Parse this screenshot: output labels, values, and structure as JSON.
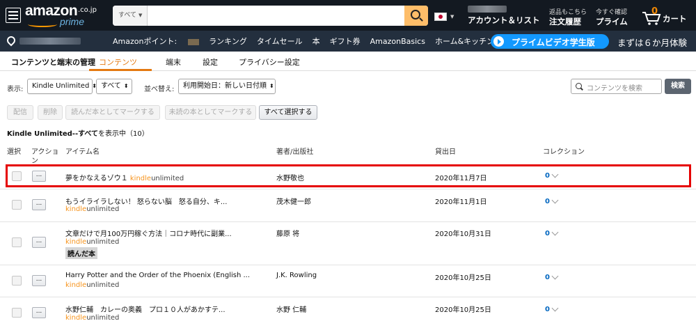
{
  "nav": {
    "logo_text": "amazon",
    "logo_tld": ".co.jp",
    "logo_prime": "prime",
    "search_category": "すべて",
    "account_label": "アカウント＆リスト",
    "orders_small": "返品もこちら",
    "orders_label": "注文履歴",
    "prime_small": "今すぐ確認",
    "prime_label": "プライム",
    "cart_count": "0",
    "cart_label": "カート"
  },
  "subnav": {
    "links": [
      "Amazonポイント:",
      "ランキング",
      "タイムセール",
      "本",
      "ギフト券",
      "AmazonBasics",
      "ホーム&キッチン"
    ],
    "promo_label": "プライムビデオ学生版",
    "promo_tail": "まずは６か月体験"
  },
  "tabs": {
    "manager_title": "コンテンツと端末の管理",
    "items": [
      "コンテンツ",
      "端末",
      "設定",
      "プライバシー設定"
    ],
    "active_index": 0
  },
  "filters": {
    "show_label": "表示:",
    "type_value": "Kindle Unlimited",
    "scope_value": "すべて",
    "sort_label": "並べ替え:",
    "sort_value": "利用開始日：新しい日付順",
    "search_placeholder": "コンテンツを検索",
    "search_button": "検索"
  },
  "actions": {
    "deliver": "配信",
    "delete": "削除",
    "mark_read": "読んだ本としてマークする",
    "mark_unread": "未読の本としてマークする",
    "select_all": "すべて選択する"
  },
  "summary": {
    "prefix": "Kindle Unlimited--すべて",
    "suffix": "を表示中（10）"
  },
  "table": {
    "headers": {
      "select": "選択",
      "action": "アクショ",
      "action2": "ン",
      "item": "アイテム名",
      "author": "著者/出版社",
      "date": "貸出日",
      "collection": "コレクション"
    },
    "ku_kindle": "kindle",
    "ku_unlimited": "unlimited",
    "dots": "...",
    "read_badge": "読んだ本",
    "rows": [
      {
        "title": "夢をかなえるゾウ１",
        "author": "水野敬也",
        "date": "2020年11月7日",
        "collection": "0"
      },
      {
        "title": "もうイライラしない！ 怒らない脳　怒る自分、キ...",
        "author": "茂木健一郎",
        "date": "2020年11月1日",
        "collection": "0"
      },
      {
        "title": "文章だけで月100万円稼ぐ方法｜コロナ時代に副業...",
        "author": "藤原 将",
        "date": "2020年10月31日",
        "collection": "0"
      },
      {
        "title": "Harry Potter and the Order of the Phoenix (English ...",
        "author": "J.K. Rowling",
        "date": "2020年10月25日",
        "collection": "0"
      },
      {
        "title": "水野仁輔　カレーの奥義　プロ１０人があかすテ...",
        "author": "水野 仁輔",
        "date": "2020年10月25日",
        "collection": "0"
      }
    ]
  },
  "colors": {
    "accent": "#e47911",
    "nav_dark": "#131921",
    "nav_sub": "#232f3e",
    "highlight": "#e50000",
    "link": "#0066c0"
  }
}
